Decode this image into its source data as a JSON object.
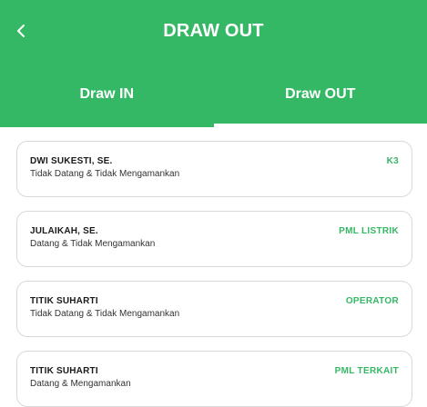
{
  "header": {
    "title": "DRAW OUT",
    "back_icon": "chevron-left-icon"
  },
  "tabs": [
    {
      "label": "Draw IN",
      "active": false
    },
    {
      "label": "Draw OUT",
      "active": true
    }
  ],
  "items": [
    {
      "name": "DWI SUKESTI, SE.",
      "status": "Tidak Datang & Tidak Mengamankan",
      "role": "K3"
    },
    {
      "name": "JULAIKAH, SE.",
      "status": "Datang & Tidak Mengamankan",
      "role": "PML LISTRIK"
    },
    {
      "name": "TITIK SUHARTI",
      "status": "Tidak Datang & Tidak Mengamankan",
      "role": "OPERATOR"
    },
    {
      "name": "TITIK SUHARTI",
      "status": "Datang & Mengamankan",
      "role": "PML TERKAIT"
    }
  ],
  "colors": {
    "primary": "#35b865",
    "text": "#1a1a1a",
    "card_border": "#d9d9d9"
  }
}
